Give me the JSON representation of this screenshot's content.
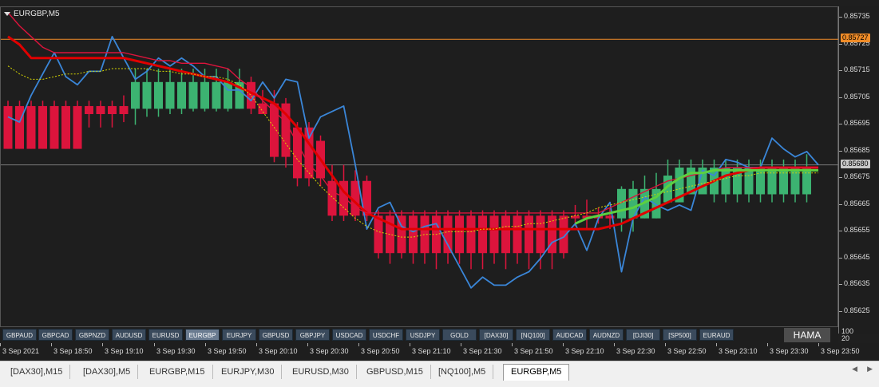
{
  "chart_title": "EURGBP,M5",
  "price_labels": [
    "0.85735",
    "0.85725",
    "0.85715",
    "0.85705",
    "0.85695",
    "0.85685",
    "0.85675",
    "0.85665",
    "0.85655",
    "0.85645",
    "0.85635",
    "0.85625"
  ],
  "price_tags": {
    "orange": "0.85727",
    "current": "0.85680"
  },
  "colors": {
    "bull": "#3cb371",
    "bear": "#dc143c",
    "blue": "#3a86d8",
    "red": "#e00000",
    "green": "#5cd040",
    "yellow": "#d8d800",
    "orange": "#f08c28"
  },
  "symbols": [
    {
      "label": "GBPAUD"
    },
    {
      "label": "GBPCAD"
    },
    {
      "label": "GBPNZD"
    },
    {
      "label": "AUDUSD"
    },
    {
      "label": "EURUSD"
    },
    {
      "label": "EURGBP",
      "active": true
    },
    {
      "label": "EURJPY"
    },
    {
      "label": "GBPUSD"
    },
    {
      "label": "GBPJPY"
    },
    {
      "label": "USDCAD"
    },
    {
      "label": "USDCHF"
    },
    {
      "label": "USDJPY"
    },
    {
      "label": "GOLD"
    },
    {
      "label": "[DAX30]"
    },
    {
      "label": "[NQ100]"
    },
    {
      "label": "AUDCAD"
    },
    {
      "label": "AUDNZD"
    },
    {
      "label": "[DJI30]"
    },
    {
      "label": "[SP500]"
    },
    {
      "label": "EURAUD"
    }
  ],
  "hama_label": "HAMA",
  "indicator_scale": [
    "100",
    "20"
  ],
  "time_labels": [
    "3 Sep 2021",
    "3 Sep 18:50",
    "3 Sep 19:10",
    "3 Sep 19:30",
    "3 Sep 19:50",
    "3 Sep 20:10",
    "3 Sep 20:30",
    "3 Sep 20:50",
    "3 Sep 21:10",
    "3 Sep 21:30",
    "3 Sep 21:50",
    "3 Sep 22:10",
    "3 Sep 22:30",
    "3 Sep 22:50",
    "3 Sep 23:10",
    "3 Sep 23:30",
    "3 Sep 23:50"
  ],
  "tabs": [
    {
      "label": "[DAX30],M15"
    },
    {
      "label": "[DAX30],M5"
    },
    {
      "label": "EURGBP,M15"
    },
    {
      "label": "EURJPY,M30"
    },
    {
      "label": "EURUSD,M30"
    },
    {
      "label": "GBPUSD,M15"
    },
    {
      "label": "[NQ100],M5"
    },
    {
      "label": "EURGBP,M5",
      "active": true
    }
  ],
  "chart_data": {
    "type": "candlestick",
    "symbol": "EURGBP",
    "timeframe": "M5",
    "ylim": [
      0.85619,
      0.85739
    ],
    "orange_level": 0.85727,
    "current_level": 0.8568,
    "candles": [
      {
        "o": 0.85702,
        "c": 0.85686,
        "h": 0.85704,
        "l": 0.85686
      },
      {
        "o": 0.85702,
        "c": 0.85686,
        "h": 0.85704,
        "l": 0.85686
      },
      {
        "o": 0.85702,
        "c": 0.85686,
        "h": 0.85704,
        "l": 0.85686
      },
      {
        "o": 0.85702,
        "c": 0.85686,
        "h": 0.85704,
        "l": 0.85686
      },
      {
        "o": 0.85702,
        "c": 0.85686,
        "h": 0.85704,
        "l": 0.85686
      },
      {
        "o": 0.85702,
        "c": 0.85686,
        "h": 0.85704,
        "l": 0.85686
      },
      {
        "o": 0.85702,
        "c": 0.85686,
        "h": 0.85704,
        "l": 0.85686
      },
      {
        "o": 0.85702,
        "c": 0.85699,
        "h": 0.85704,
        "l": 0.85694
      },
      {
        "o": 0.85702,
        "c": 0.85699,
        "h": 0.85704,
        "l": 0.85694
      },
      {
        "o": 0.85702,
        "c": 0.85699,
        "h": 0.85704,
        "l": 0.85694
      },
      {
        "o": 0.85702,
        "c": 0.85699,
        "h": 0.85706,
        "l": 0.85696
      },
      {
        "o": 0.85701,
        "c": 0.85711,
        "h": 0.85716,
        "l": 0.85695
      },
      {
        "o": 0.85701,
        "c": 0.85711,
        "h": 0.85716,
        "l": 0.85698
      },
      {
        "o": 0.85701,
        "c": 0.85711,
        "h": 0.85716,
        "l": 0.85698
      },
      {
        "o": 0.85701,
        "c": 0.85711,
        "h": 0.85716,
        "l": 0.85699
      },
      {
        "o": 0.85701,
        "c": 0.85711,
        "h": 0.85716,
        "l": 0.85699
      },
      {
        "o": 0.85701,
        "c": 0.85711,
        "h": 0.85716,
        "l": 0.857
      },
      {
        "o": 0.85701,
        "c": 0.85711,
        "h": 0.85716,
        "l": 0.857
      },
      {
        "o": 0.85701,
        "c": 0.85711,
        "h": 0.85716,
        "l": 0.857
      },
      {
        "o": 0.85701,
        "c": 0.85711,
        "h": 0.85716,
        "l": 0.857
      },
      {
        "o": 0.85701,
        "c": 0.85711,
        "h": 0.85716,
        "l": 0.85701
      },
      {
        "o": 0.85711,
        "c": 0.85701,
        "h": 0.85713,
        "l": 0.85699
      },
      {
        "o": 0.85703,
        "c": 0.85699,
        "h": 0.85708,
        "l": 0.85699
      },
      {
        "o": 0.85703,
        "c": 0.85683,
        "h": 0.85708,
        "l": 0.85681
      },
      {
        "o": 0.85703,
        "c": 0.85683,
        "h": 0.85705,
        "l": 0.85679
      },
      {
        "o": 0.85694,
        "c": 0.85675,
        "h": 0.85696,
        "l": 0.85672
      },
      {
        "o": 0.85694,
        "c": 0.85675,
        "h": 0.85696,
        "l": 0.85672
      },
      {
        "o": 0.85689,
        "c": 0.85675,
        "h": 0.85691,
        "l": 0.85672
      },
      {
        "o": 0.85674,
        "c": 0.85661,
        "h": 0.8568,
        "l": 0.85659
      },
      {
        "o": 0.85674,
        "c": 0.85661,
        "h": 0.8568,
        "l": 0.85659
      },
      {
        "o": 0.85674,
        "c": 0.85661,
        "h": 0.85678,
        "l": 0.85659
      },
      {
        "o": 0.85674,
        "c": 0.85661,
        "h": 0.85676,
        "l": 0.85659
      },
      {
        "o": 0.85661,
        "c": 0.85647,
        "h": 0.85663,
        "l": 0.85645
      },
      {
        "o": 0.85661,
        "c": 0.85647,
        "h": 0.85663,
        "l": 0.85643
      },
      {
        "o": 0.85661,
        "c": 0.85647,
        "h": 0.85663,
        "l": 0.85645
      },
      {
        "o": 0.85661,
        "c": 0.85647,
        "h": 0.85663,
        "l": 0.85643
      },
      {
        "o": 0.85661,
        "c": 0.85647,
        "h": 0.85663,
        "l": 0.85643
      },
      {
        "o": 0.85661,
        "c": 0.85647,
        "h": 0.85663,
        "l": 0.85641
      },
      {
        "o": 0.85661,
        "c": 0.85647,
        "h": 0.85663,
        "l": 0.85643
      },
      {
        "o": 0.85661,
        "c": 0.85647,
        "h": 0.85663,
        "l": 0.85643
      },
      {
        "o": 0.85661,
        "c": 0.85647,
        "h": 0.85663,
        "l": 0.85641
      },
      {
        "o": 0.85661,
        "c": 0.85647,
        "h": 0.85663,
        "l": 0.85641
      },
      {
        "o": 0.85661,
        "c": 0.85647,
        "h": 0.85663,
        "l": 0.85643
      },
      {
        "o": 0.85661,
        "c": 0.85647,
        "h": 0.85663,
        "l": 0.85641
      },
      {
        "o": 0.85661,
        "c": 0.85647,
        "h": 0.85663,
        "l": 0.85643
      },
      {
        "o": 0.85661,
        "c": 0.85647,
        "h": 0.85663,
        "l": 0.85641
      },
      {
        "o": 0.85661,
        "c": 0.85647,
        "h": 0.85663,
        "l": 0.85641
      },
      {
        "o": 0.85661,
        "c": 0.85647,
        "h": 0.85663,
        "l": 0.85641
      },
      {
        "o": 0.85661,
        "c": 0.85647,
        "h": 0.85663,
        "l": 0.85645
      },
      {
        "o": 0.85661,
        "c": 0.8566,
        "h": 0.85665,
        "l": 0.85657
      },
      {
        "o": 0.85661,
        "c": 0.8566,
        "h": 0.85667,
        "l": 0.85656
      },
      {
        "o": 0.85661,
        "c": 0.8566,
        "h": 0.85664,
        "l": 0.85658
      },
      {
        "o": 0.85661,
        "c": 0.8566,
        "h": 0.85664,
        "l": 0.85656
      },
      {
        "o": 0.8566,
        "c": 0.85671,
        "h": 0.85672,
        "l": 0.85655
      },
      {
        "o": 0.8566,
        "c": 0.85671,
        "h": 0.85674,
        "l": 0.85655
      },
      {
        "o": 0.8566,
        "c": 0.85671,
        "h": 0.85676,
        "l": 0.8566
      },
      {
        "o": 0.8566,
        "c": 0.85671,
        "h": 0.85677,
        "l": 0.8566
      },
      {
        "o": 0.85666,
        "c": 0.85676,
        "h": 0.85682,
        "l": 0.85666
      },
      {
        "o": 0.85666,
        "c": 0.85679,
        "h": 0.85682,
        "l": 0.85666
      },
      {
        "o": 0.85669,
        "c": 0.85679,
        "h": 0.85682,
        "l": 0.85669
      },
      {
        "o": 0.85669,
        "c": 0.85679,
        "h": 0.85682,
        "l": 0.85669
      },
      {
        "o": 0.85669,
        "c": 0.85679,
        "h": 0.85682,
        "l": 0.85666
      },
      {
        "o": 0.85669,
        "c": 0.85679,
        "h": 0.85682,
        "l": 0.85666
      },
      {
        "o": 0.85669,
        "c": 0.85679,
        "h": 0.85682,
        "l": 0.85666
      },
      {
        "o": 0.85669,
        "c": 0.85679,
        "h": 0.85682,
        "l": 0.85666
      },
      {
        "o": 0.85669,
        "c": 0.85679,
        "h": 0.85682,
        "l": 0.85666
      },
      {
        "o": 0.85669,
        "c": 0.85679,
        "h": 0.85682,
        "l": 0.85666
      },
      {
        "o": 0.85669,
        "c": 0.85679,
        "h": 0.85682,
        "l": 0.85666
      },
      {
        "o": 0.85669,
        "c": 0.85679,
        "h": 0.85682,
        "l": 0.85666
      },
      {
        "o": 0.85669,
        "c": 0.85679,
        "h": 0.85684,
        "l": 0.85666
      }
    ],
    "series": [
      {
        "color": "blue",
        "values": [
          0.85698,
          0.85696,
          0.85706,
          0.85714,
          0.85722,
          0.85713,
          0.8571,
          0.85715,
          0.85715,
          0.85728,
          0.8572,
          0.85712,
          0.85715,
          0.8572,
          0.85717,
          0.8572,
          0.85717,
          0.85713,
          0.85713,
          0.85708,
          0.85708,
          0.85704,
          0.85711,
          0.85705,
          0.85712,
          0.85711,
          0.8569,
          0.85698,
          0.857,
          0.85702,
          0.8568,
          0.85656,
          0.85664,
          0.85666,
          0.85657,
          0.85655,
          0.85657,
          0.85658,
          0.8565,
          0.85642,
          0.85634,
          0.85638,
          0.85635,
          0.85635,
          0.85638,
          0.8564,
          0.85645,
          0.85651,
          0.85653,
          0.85658,
          0.85648,
          0.8566,
          0.85666,
          0.8564,
          0.8566,
          0.85668,
          0.85665,
          0.85663,
          0.85665,
          0.85663,
          0.85678,
          0.85676,
          0.85682,
          0.85681,
          0.85679,
          0.85679,
          0.8569,
          0.85686,
          0.85683,
          0.85685,
          0.8568
        ]
      },
      {
        "color": "red",
        "values": [
          0.85728,
          0.85725,
          0.8572,
          0.8572,
          0.8572,
          0.8572,
          0.8572,
          0.8572,
          0.8572,
          0.8572,
          0.8572,
          0.85719,
          0.85718,
          0.85717,
          0.85716,
          0.85715,
          0.85714,
          0.85713,
          0.85712,
          0.85711,
          0.85709,
          0.85707,
          0.85705,
          0.85703,
          0.85699,
          0.85694,
          0.85688,
          0.85682,
          0.85676,
          0.8567,
          0.85666,
          0.85662,
          0.8566,
          0.85658,
          0.85656,
          0.85656,
          0.85656,
          0.85656,
          0.85656,
          0.85656,
          0.85656,
          0.85656,
          0.85656,
          0.85656,
          0.85656,
          0.85656,
          0.85656,
          0.85656,
          0.85656,
          0.85656,
          0.85656,
          0.85656,
          0.85657,
          0.85658,
          0.8566,
          0.85662,
          0.85664,
          0.85666,
          0.85668,
          0.8567,
          0.85672,
          0.85674,
          0.85676,
          0.85677,
          0.85678,
          0.85679,
          0.85679,
          0.85679,
          0.85679,
          0.85679,
          0.85679
        ]
      },
      {
        "color": "red-thin",
        "values": [
          0.85737,
          0.85732,
          0.85728,
          0.85724,
          0.85722,
          0.85722,
          0.85722,
          0.85722,
          0.85722,
          0.85722,
          0.85722,
          0.85721,
          0.8572,
          0.85719,
          0.85719,
          0.85718,
          0.85718,
          0.85718,
          0.85717,
          0.85716,
          0.85712,
          0.85709,
          0.85704,
          0.857,
          0.85696,
          0.85688,
          0.8568,
          0.85676,
          0.8567,
          0.85668,
          0.85664,
          0.85662,
          0.85662,
          0.85662,
          0.85662,
          0.85662,
          0.85662,
          0.85662,
          0.85662,
          0.85662,
          0.85662,
          0.85662,
          0.85662,
          0.85662,
          0.85662,
          0.85662,
          0.85662,
          0.85662,
          0.85662,
          0.85662,
          0.85662,
          0.85662,
          0.85664,
          0.85666,
          0.85668,
          0.8567,
          0.85672,
          0.85674,
          0.85675,
          0.85676,
          0.85677,
          0.85678,
          0.85679,
          0.85679,
          0.85679,
          0.85679,
          0.85679,
          0.85679,
          0.85679,
          0.85679,
          0.85679
        ]
      },
      {
        "color": "yellow",
        "values": [
          0.85717,
          0.85714,
          0.85712,
          0.85712,
          0.85713,
          0.85714,
          0.85714,
          0.85715,
          0.85715,
          0.85716,
          0.85716,
          0.85716,
          0.85716,
          0.85715,
          0.85715,
          0.85714,
          0.85714,
          0.85713,
          0.85713,
          0.85712,
          0.8571,
          0.85706,
          0.857,
          0.85694,
          0.85688,
          0.85682,
          0.85677,
          0.85672,
          0.85668,
          0.85664,
          0.8566,
          0.85657,
          0.85655,
          0.85654,
          0.85653,
          0.85653,
          0.85654,
          0.85654,
          0.85655,
          0.85655,
          0.85655,
          0.85656,
          0.85656,
          0.85657,
          0.85657,
          0.85658,
          0.85658,
          0.85659,
          0.8566,
          0.85661,
          0.85662,
          0.85664,
          0.85665,
          0.85666,
          0.85667,
          0.85668,
          0.85669,
          0.8567,
          0.85671,
          0.85672,
          0.85673,
          0.85674,
          0.85675,
          0.85676,
          0.85676,
          0.85677,
          0.85677,
          0.85677,
          0.85677,
          0.85677,
          0.85677
        ]
      },
      {
        "color": "green",
        "start": 49,
        "values": [
          0.85658,
          0.8566,
          0.85661,
          0.85662,
          0.85663,
          0.85664,
          0.85666,
          0.85668,
          0.85672,
          0.85675,
          0.85677,
          0.85677,
          0.85678,
          0.85678,
          0.85678,
          0.85678,
          0.85678,
          0.85678,
          0.85678,
          0.85678,
          0.85678,
          0.85678
        ]
      }
    ]
  }
}
